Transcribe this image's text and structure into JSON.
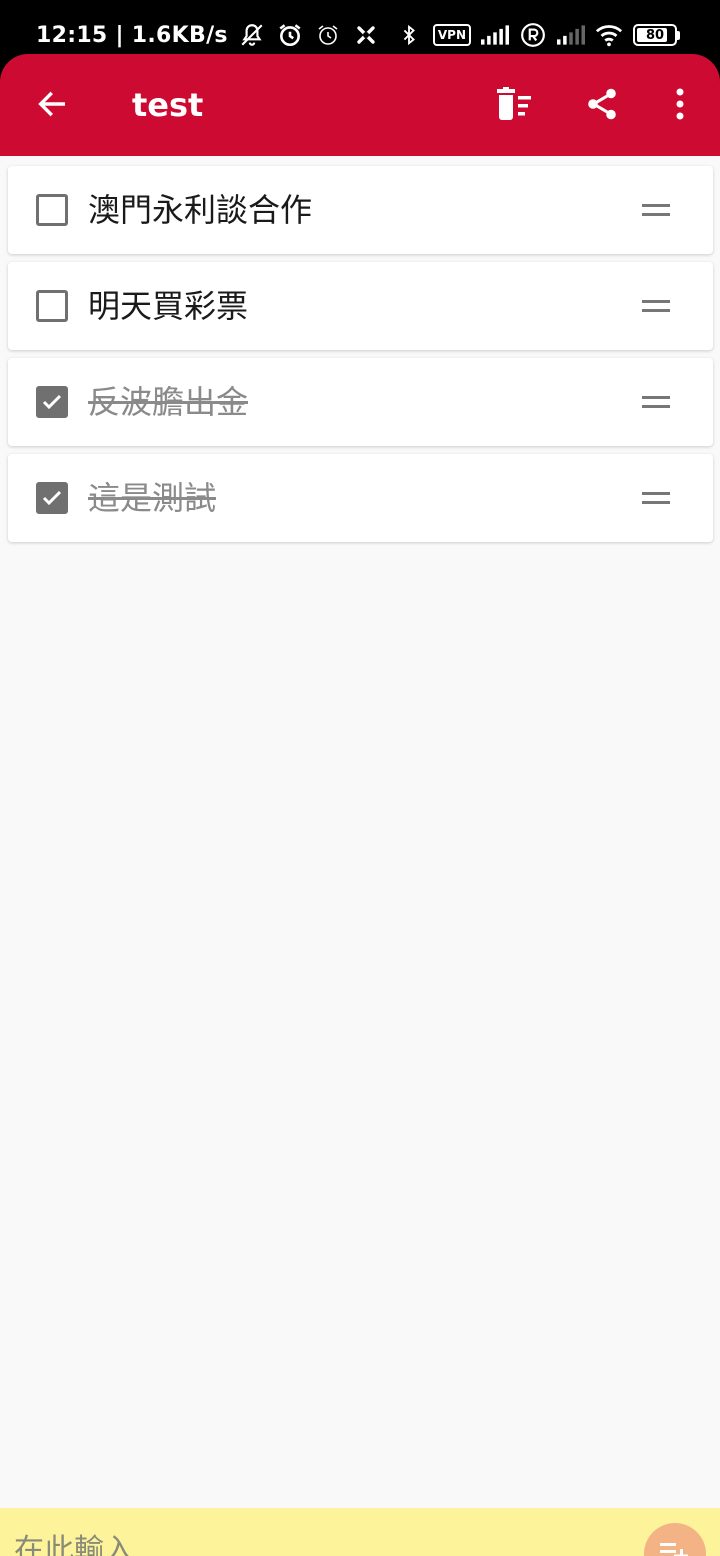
{
  "status_bar": {
    "time": "12:15 | 1.6KB/s",
    "vpn_label": "VPN",
    "battery": "80"
  },
  "app_bar": {
    "title": "test",
    "color": "#cd0a32"
  },
  "items": [
    {
      "text": "澳門永利談合作",
      "checked": false
    },
    {
      "text": "明天買彩票",
      "checked": false
    },
    {
      "text": "反波膽出金",
      "checked": true
    },
    {
      "text": "這是測試",
      "checked": true
    }
  ],
  "input": {
    "placeholder": "在此輸入",
    "bar_color": "#fdf39a",
    "fab_color": "#f3b384"
  }
}
